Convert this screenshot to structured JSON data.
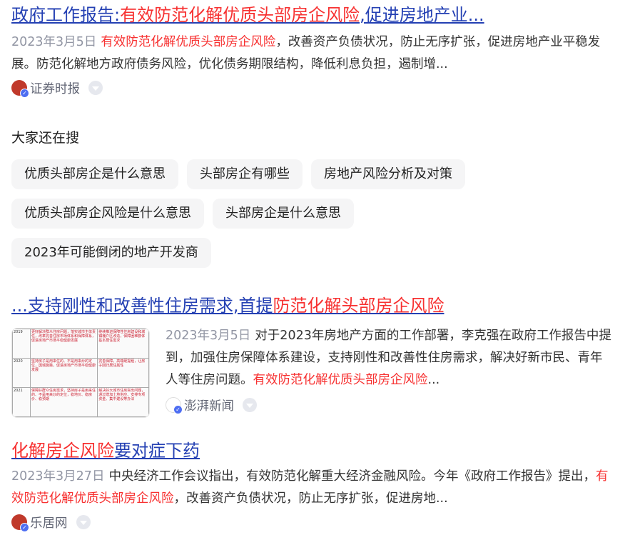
{
  "results": [
    {
      "title_parts": [
        "政府工作报告:",
        "有效防范化解优质头部房企风险",
        ",促进房地产业..."
      ],
      "date": "2023年3月5日",
      "snippet_hl": "有效防范化解优质头部房企风险",
      "snippet_rest": "，改善资产负债状况，防止无序扩张，促进房地产业平稳发展。防范化解地方政府债务风险，优化债务期限结构，降低利息负担，遏制增...",
      "source": "证券时报"
    },
    {
      "title_parts": [
        "...支持刚性和改善性住房需求,首提",
        "防范化解头部房企风险"
      ],
      "date": "2023年3月5日",
      "snippet_pre": "对于2023年房地产方面的工作部署，李克强在政府工作报告中提到，加强住房保障体系建设，支持刚性和改善性住房需求，解决好新市民、青年人等住房问题。",
      "snippet_hl": "有效防范化解优质头部房企风险",
      "snippet_post": "...",
      "source": "澎湃新闻",
      "thumb_rows": [
        {
          "year": "2019",
          "c1": "更好解决群众住房问题，落实城市主体责任，改革完善住房市场体系和保障体系，促进房地产市场平稳健康发展",
          "c2": "继续推进保障性住房建设和城镇棚户区改造，保障困难群体基本居住需求"
        },
        {
          "year": "2020",
          "c1": "坚持房子是用来住的、不是用来炒的定位，因城施策，促进房地产市场平稳健康发展",
          "c2": "完善保障，高端硬提租，让房子回归居住属性"
        },
        {
          "year": "2021",
          "c1": "保障好群众住房需求，坚持房子是用来住的、不是用来炒的定位，稳地价、稳房价、稳预期",
          "c2": "解决好大城市住房突出问题，通过增加土地供应、安排专项资金、集中建设等办法"
        }
      ]
    },
    {
      "title_parts": [
        "化解房企风险",
        "要对症下药"
      ],
      "date": "2023年3月27日",
      "snippet_pre": "中央经济工作会议指出，有效防范化解重大经济金融风险。今年《政府工作报告》提出，",
      "snippet_hl": "有效防范化解优质头部房企风险",
      "snippet_post": "，改善资产负债状况，防止无序扩张，促进房地...",
      "source": "乐居网"
    }
  ],
  "related": {
    "title": "大家还在搜",
    "chips": [
      [
        "优质头部房企是什么意思",
        "头部房企有哪些",
        "房地产风险分析及对策"
      ],
      [
        "优质头部房企风险是什么意思",
        "头部房企是什么意思"
      ],
      [
        "2023年可能倒闭的地产开发商"
      ]
    ]
  },
  "icons": {
    "verified_badge": "verified-icon",
    "more": "chevron-down-icon"
  },
  "colors": {
    "link": "#2440b3",
    "highlight": "#f73131",
    "date": "#9195a3",
    "chip_bg": "#f5f5f6"
  }
}
